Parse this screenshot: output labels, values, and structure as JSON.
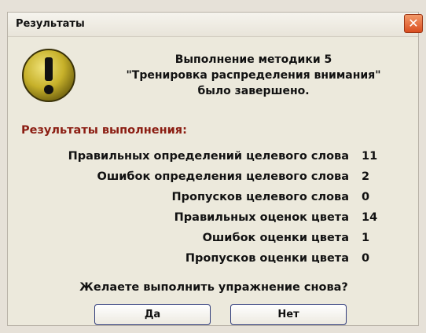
{
  "window": {
    "title": "Результаты",
    "close_icon": "close-icon"
  },
  "message": {
    "lines": [
      "Выполнение методики 5",
      "\"Тренировка распределения внимания\"",
      "было завершено."
    ]
  },
  "results": {
    "title": "Результаты выполнения:",
    "rows": [
      {
        "label": "Правильных определений целевого слова",
        "value": "11"
      },
      {
        "label": "Ошибок определения целевого слова",
        "value": "2"
      },
      {
        "label": "Пропусков целевого слова",
        "value": "0"
      },
      {
        "label": "Правильных оценок цвета",
        "value": "14"
      },
      {
        "label": "Ошибок оценки цвета",
        "value": "1"
      },
      {
        "label": "Пропусков оценки цвета",
        "value": "0"
      }
    ]
  },
  "question": "Желаете выполнить упражнение снова?",
  "buttons": {
    "yes": "Да",
    "no": "Нет"
  },
  "colors": {
    "results_title": "#8b1d12",
    "icon_fill": "#c7b12a",
    "close_button": "#d94d1f"
  }
}
